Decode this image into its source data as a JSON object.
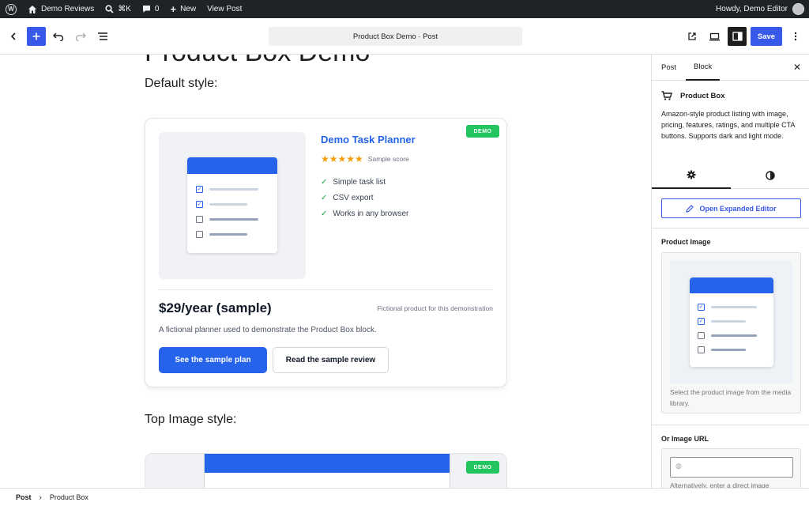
{
  "admin_bar": {
    "site_name": "Demo Reviews",
    "search_shortcut": "⌘K",
    "comments_count": "0",
    "new_label": "New",
    "view_post_label": "View Post",
    "howdy": "Howdy, Demo Editor"
  },
  "toolbar": {
    "document_title": "Product Box Demo · Post",
    "save_label": "Save",
    "accent_color": "#3858e9"
  },
  "canvas": {
    "post_title": "Product Box Demo",
    "default_style_heading": "Default style:",
    "top_image_style_heading": "Top Image style:",
    "product_box": {
      "badge": "DEMO",
      "name": "Demo Task Planner",
      "stars": "★★★★★",
      "rating": 5,
      "score_label": "Sample score",
      "features": [
        "Simple task list",
        "CSV export",
        "Works in any browser"
      ],
      "price": "$29/year (sample)",
      "disclaimer": "Fictional product for this demonstration",
      "description": "A fictional planner used to demonstrate the Product Box block.",
      "primary_cta": "See the sample plan",
      "secondary_cta": "Read the sample review",
      "primary_color": "#2563eb",
      "badge_color": "#22c55e",
      "star_color": "#f59e0b"
    },
    "product_box_2": {
      "badge": "DEMO"
    }
  },
  "sidebar": {
    "tabs": [
      "Post",
      "Block"
    ],
    "active_tab": "Block",
    "block_name": "Product Box",
    "block_description": "Amazon-style product listing with image, pricing, features, ratings, and multiple CTA buttons. Supports dark and light mode.",
    "subtabs": [
      "settings-icon",
      "styles-icon"
    ],
    "expanded_editor_label": "Open Expanded Editor",
    "product_image_label": "Product Image",
    "product_image_help": "Select the product image from the media library.",
    "image_url_label": "Or Image URL",
    "image_url_value": "",
    "image_url_help": "Alternatively, enter a direct image"
  },
  "footer": {
    "breadcrumb": [
      "Post",
      "Product Box"
    ]
  }
}
